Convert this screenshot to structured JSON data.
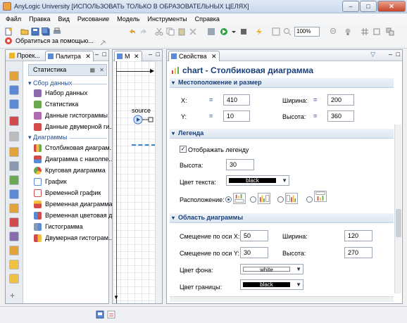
{
  "window": {
    "title": "AnyLogic University [ИСПОЛЬЗОВАТЬ ТОЛЬКО В ОБРАЗОВАТЕЛЬНЫХ ЦЕЛЯХ]",
    "minimize": "–",
    "maximize": "□",
    "close": "✕"
  },
  "menu": [
    "Файл",
    "Правка",
    "Вид",
    "Рисование",
    "Модель",
    "Инструменты",
    "Справка"
  ],
  "toolbar": {
    "help_label": "Обратиться за помощью...",
    "zoom": "100%"
  },
  "left_tabs": {
    "projects": "Проек...",
    "palette": "Палитра"
  },
  "palette": {
    "header": "Статистика",
    "categories": [
      {
        "label": "Сбор данных",
        "items": [
          "Набор данных",
          "Статистика",
          "Данные гистограммы",
          "Данные двумерной ги..."
        ]
      },
      {
        "label": "Диаграммы",
        "items": [
          "Столбиковая диаграм...",
          "Диаграмма с наколпе...",
          "Круговая диаграмма",
          "График",
          "Временной график",
          "Временная диаграмма...",
          "Временная цветовая д...",
          "Гистограмма",
          "Двумерная гистограм..."
        ]
      }
    ]
  },
  "editor": {
    "tab": "M",
    "source_label": "source"
  },
  "properties": {
    "tab": "Свойства",
    "header": "chart - Столбиковая диаграмма",
    "sections": {
      "location": "Местоположение и размер",
      "legend": "Легенда",
      "chart_area": "Область диаграммы"
    },
    "location": {
      "x_label": "X:",
      "x_value": "410",
      "y_label": "Y:",
      "y_value": "10",
      "width_label": "Ширина:",
      "width_value": "200",
      "height_label": "Высота:",
      "height_value": "360"
    },
    "legend": {
      "show_label": "Отображать легенду",
      "height_label": "Высота:",
      "height_value": "30",
      "text_color_label": "Цвет текста:",
      "text_color_value": "black",
      "position_label": "Расположение:"
    },
    "chart_area": {
      "offset_x_label": "Смещение по оси X:",
      "offset_x_value": "50",
      "offset_y_label": "Смещение по оси Y:",
      "offset_y_value": "30",
      "width_label": "Ширина:",
      "width_value": "120",
      "height_label": "Высота:",
      "height_value": "270",
      "bg_color_label": "Цвет фона:",
      "bg_color_value": "white",
      "border_color_label": "Цвет границы:",
      "border_color_value": "black"
    }
  },
  "colors": {
    "accent": "#1a3f7a",
    "black_swatch": "#000000",
    "white_swatch": "#ffffff"
  }
}
